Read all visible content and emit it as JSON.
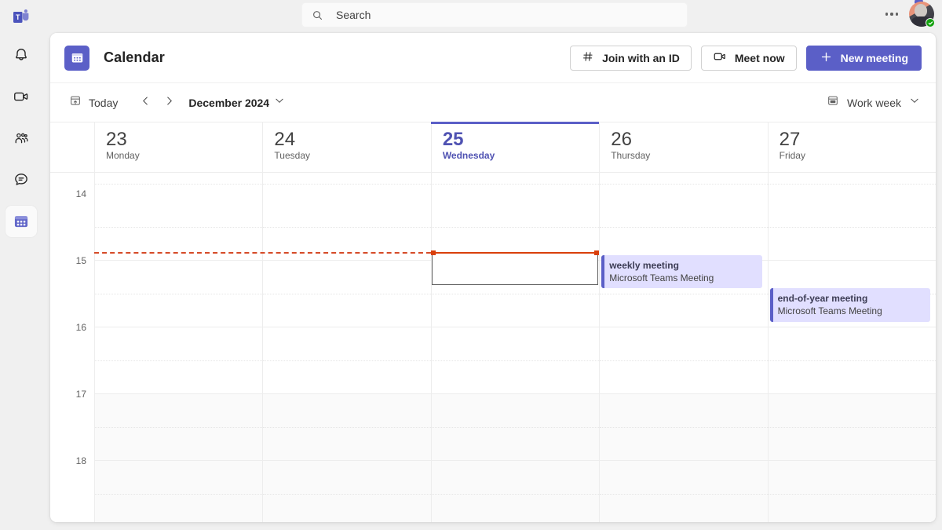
{
  "rail": {
    "logo_icon": "teams-logo-icon",
    "items": [
      {
        "name": "activity",
        "icon": "bell-icon",
        "label": "Activity",
        "active": false
      },
      {
        "name": "meet",
        "icon": "video-camera-icon",
        "label": "Meet",
        "active": false
      },
      {
        "name": "communities",
        "icon": "people-icon",
        "label": "Communities",
        "active": false
      },
      {
        "name": "chat",
        "icon": "chat-bubble-icon",
        "label": "Chat",
        "active": false
      },
      {
        "name": "calendar",
        "icon": "calendar-icon",
        "label": "Calendar",
        "active": true
      }
    ]
  },
  "topbar": {
    "search": {
      "placeholder": "Search",
      "value": "",
      "icon": "search-icon"
    },
    "more_icon": "more-horizontal-icon",
    "avatar": {
      "name": "avatar",
      "presence": "available",
      "presence_color": "#13a10e"
    },
    "notification_badge": true
  },
  "header": {
    "app_icon": "calendar-icon",
    "title": "Calendar",
    "buttons": [
      {
        "name": "join-with-id",
        "label": "Join with an ID",
        "icon": "hash-icon",
        "primary": false
      },
      {
        "name": "meet-now",
        "label": "Meet now",
        "icon": "video-camera-icon",
        "primary": false
      },
      {
        "name": "new-meeting",
        "label": "New meeting",
        "icon": "plus-icon",
        "primary": true
      }
    ]
  },
  "toolbar": {
    "today_label": "Today",
    "today_icon": "calendar-today-icon",
    "prev_icon": "chevron-left-icon",
    "next_icon": "chevron-right-icon",
    "period_label": "December 2024",
    "period_dropdown_icon": "chevron-down-icon",
    "view_label": "Work week",
    "view_icon": "work-week-icon",
    "view_dropdown_icon": "chevron-down-icon"
  },
  "calendar": {
    "days": [
      {
        "num": "23",
        "weekday": "Monday",
        "today": false
      },
      {
        "num": "24",
        "weekday": "Tuesday",
        "today": false
      },
      {
        "num": "25",
        "weekday": "Wednesday",
        "today": true
      },
      {
        "num": "26",
        "weekday": "Thursday",
        "today": false
      },
      {
        "num": "27",
        "weekday": "Friday",
        "today": false
      }
    ],
    "hours": [
      {
        "label": "14",
        "offhours": false
      },
      {
        "label": "15",
        "offhours": false
      },
      {
        "label": "16",
        "offhours": false
      },
      {
        "label": "17",
        "offhours": true
      },
      {
        "label": "18",
        "offhours": true
      }
    ],
    "current_time_marker": {
      "day_index": 2,
      "time": "14:52"
    },
    "selected_slot": {
      "day_index": 2,
      "start": "14:52",
      "end": "15:22"
    },
    "events": [
      {
        "title": "weekly meeting",
        "subtitle": "Microsoft Teams Meeting",
        "day_index": 3,
        "start": "14:55",
        "end": "15:25",
        "accent_color": "#5b5fc7",
        "background_color": "#e1dfff"
      },
      {
        "title": "end-of-year meeting",
        "subtitle": "Microsoft Teams Meeting",
        "day_index": 4,
        "start": "15:25",
        "end": "15:55",
        "accent_color": "#5b5fc7",
        "background_color": "#e1dfff"
      }
    ]
  },
  "colors": {
    "accent": "#5b5fc7",
    "today_text": "#4f52b2",
    "now_line": "#d93f0b",
    "page_bg": "#f0f0f0"
  }
}
